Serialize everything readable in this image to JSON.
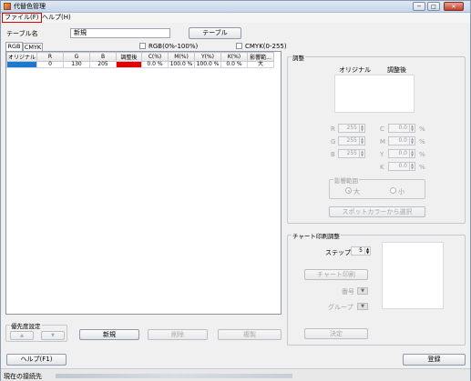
{
  "window": {
    "title": "代替色管理",
    "buttons": {
      "minimize": "─",
      "maximize": "□",
      "close": "✕"
    }
  },
  "menu": {
    "file": "ファイル(F)",
    "help": "ヘルプ(H)"
  },
  "table_name": {
    "label": "テーブル名",
    "value": "新規",
    "button": "テーブル"
  },
  "tabs": {
    "rgb": "RGB",
    "cmyk": "CMYK"
  },
  "checkboxes": {
    "rgb": "RGB(0%-100%)",
    "cmyk": "CMYK(0-255)"
  },
  "grid": {
    "headers": [
      "オリジナル",
      "R",
      "G",
      "B",
      "調整後",
      "C(%)",
      "M(%)",
      "Y(%)",
      "K(%)",
      "影響範..."
    ],
    "rows": [
      {
        "original_color": "#1a7ad0",
        "r": "0",
        "g": "130",
        "b": "205",
        "adjusted_color": "#e00000",
        "c": "0.0 %",
        "m": "100.0 %",
        "y": "100.0 %",
        "k": "0.0 %",
        "range": "大"
      }
    ]
  },
  "priority": {
    "title": "優先度設定",
    "up": "▲",
    "down": "▼"
  },
  "actions": {
    "new": "新規",
    "delete": "削除",
    "copy": "複製"
  },
  "adjust": {
    "title": "調整",
    "original_label": "オリジナル",
    "adjusted_label": "調整後",
    "r": {
      "label": "R",
      "value": "255"
    },
    "g": {
      "label": "G",
      "value": "255"
    },
    "b": {
      "label": "B",
      "value": "255"
    },
    "c": {
      "label": "C",
      "value": "0.0",
      "unit": "%"
    },
    "m": {
      "label": "M",
      "value": "0.0",
      "unit": "%"
    },
    "y": {
      "label": "Y",
      "value": "0.0",
      "unit": "%"
    },
    "k": {
      "label": "K",
      "value": "0.0",
      "unit": "%"
    },
    "range": {
      "title": "影響範囲",
      "large": "大",
      "small": "小"
    },
    "spot_button": "スポットカラーから選択"
  },
  "chart": {
    "title": "チャート印刷調整",
    "step_label": "ステップ",
    "step_value": "5",
    "print_button": "チャート印刷",
    "number_label": "番号",
    "group_label": "グループ",
    "decide_button": "決定"
  },
  "footer": {
    "help_button": "ヘルプ(F1)",
    "register_button": "登録"
  },
  "status": {
    "label": "現在の接続先"
  }
}
